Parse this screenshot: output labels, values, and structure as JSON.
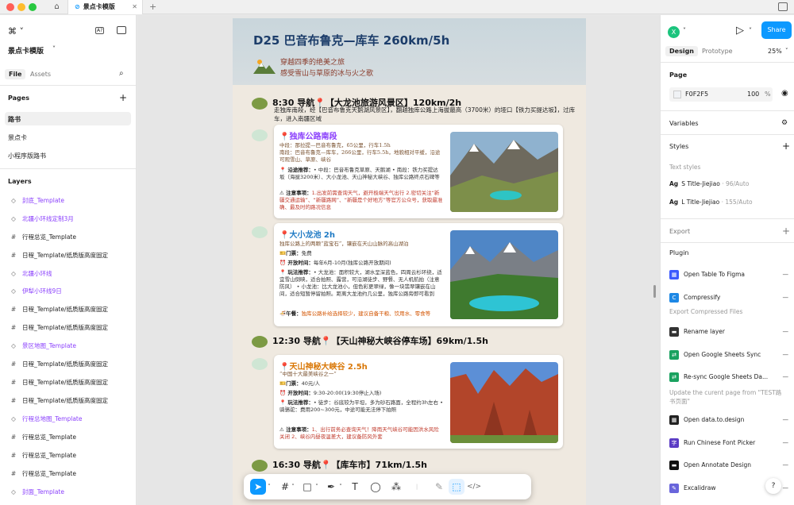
{
  "tabbar": {
    "tab_title": "景点卡模版",
    "close": "✕",
    "plus": "+"
  },
  "left_panel": {
    "file_name": "景点卡模版",
    "tab_file": "File",
    "tab_assets": "Assets",
    "pages_title": "Pages",
    "pages": [
      "路书",
      "景点卡",
      "小程序版路书"
    ],
    "layers_title": "Layers",
    "layers": [
      {
        "label": "封底_Template",
        "style": "purple",
        "icon": "◇"
      },
      {
        "label": "北疆小环线定制3月",
        "style": "purple",
        "icon": "◇"
      },
      {
        "label": "行程总览_Template",
        "style": "",
        "icon": "#"
      },
      {
        "label": "日程_Template/纸质版高度固定",
        "style": "",
        "icon": "#"
      },
      {
        "label": "北疆小环线",
        "style": "purple",
        "icon": "◇"
      },
      {
        "label": "伊犁小环线9日",
        "style": "purple",
        "icon": "◇"
      },
      {
        "label": "日程_Template/纸质版高度固定",
        "style": "",
        "icon": "#"
      },
      {
        "label": "日程_Template/纸质版高度固定",
        "style": "",
        "icon": "#"
      },
      {
        "label": "景区地图_Template",
        "style": "purple",
        "icon": "◇"
      },
      {
        "label": "日程_Template/纸质版高度固定",
        "style": "",
        "icon": "#"
      },
      {
        "label": "日程_Template/纸质版高度固定",
        "style": "",
        "icon": "#"
      },
      {
        "label": "日程_Template/纸质版高度固定",
        "style": "",
        "icon": "#"
      },
      {
        "label": "行程总地图_Template",
        "style": "purple",
        "icon": "◇"
      },
      {
        "label": "行程总览_Template",
        "style": "",
        "icon": "#"
      },
      {
        "label": "行程总览_Template",
        "style": "",
        "icon": "#"
      },
      {
        "label": "行程总览_Template",
        "style": "",
        "icon": "#"
      },
      {
        "label": "封面_Template",
        "style": "purple",
        "icon": "◇"
      }
    ]
  },
  "right_panel": {
    "avatar": "X",
    "share": "Share",
    "tab_design": "Design",
    "tab_prototype": "Prototype",
    "zoom": "25%",
    "page_title": "Page",
    "page_color": "F0F2F5",
    "page_opacity": "100",
    "page_pct": "%",
    "variables": "Variables",
    "styles": "Styles",
    "text_styles": "Text styles",
    "style1_name": "S Title-Jiejiao",
    "style1_meta": "· 96/Auto",
    "style2_name": "L Title-Jiejiao",
    "style2_meta": "· 155/Auto",
    "export": "Export",
    "plugin": "Plugin",
    "plugins": [
      {
        "name": "Open Table To Figma",
        "color": "#3d5afe",
        "glyph": "▦"
      },
      {
        "name": "Compressify",
        "color": "#1e88e5",
        "glyph": "C"
      },
      {
        "name": "Rename layer",
        "color": "#333333",
        "glyph": "▬"
      },
      {
        "name": "Open Google Sheets Sync",
        "color": "#1aa260",
        "glyph": "⇄"
      },
      {
        "name": "Re-sync Google Sheets Da...",
        "color": "#1aa260",
        "glyph": "⇄"
      },
      {
        "name": "Open data.to.design",
        "color": "#222222",
        "glyph": "▦"
      },
      {
        "name": "Run Chinese Font Picker",
        "color": "#5b3cc4",
        "glyph": "字"
      },
      {
        "name": "Open Annotate Design",
        "color": "#111111",
        "glyph": "▬"
      },
      {
        "name": "Excalidraw",
        "color": "#6965db",
        "glyph": "✎"
      }
    ],
    "compressify_sub": "Export Compressed Files",
    "resync_sub": "Update the curent page from \"TEST路书页面\"",
    "help": "?"
  },
  "frame": {
    "title": "D25 巴音布鲁克—库车 260km/5h",
    "sub1": "穿越四季的绝美之旅",
    "sub2": "感受雪山与草原的冰与火之歌",
    "nav1": "8:30 导航📍【大龙池旅游风景区】120km/2h",
    "nav1_desc": "走独库南段，经【巴音布鲁克天鹅湖风景区】，翻越独库公路上海拔最高（3700米）的垭口【铁力买提达坂】，过库车，进入南疆区域",
    "card1": {
      "title": "📍独库公路南段",
      "lines": [
        "中段：那拉提—巴音布鲁克，65公里，行车1.5h",
        "南段：巴音布鲁克—库车，266公里，行车5.5h，地貌相对平缓，沿途可观雪山、草原、峡谷"
      ],
      "rec_label": "📍 沿途推荐：",
      "rec": "• 中段：巴音布鲁克草原、天鹅湖 • 南段：铁力买提达坂（海拔3200米）、大小龙池、天山神秘大峡谷、独库公路终点石碑等",
      "note_label": "⚠ 注意事项：",
      "note": "1.出发前需查询天气，避开极端天气出行 2.密切关注“新疆交通运输”、“新疆路网”、“新疆是个好地方”等官方公众号，获取最准确、最及时的路况信息"
    },
    "card2": {
      "title": "📍大小龙池 2h",
      "intro": "独库公路上的两颗“蓝宝石”，镶嵌在天山山脉的高山湖泊",
      "ticket_label": "🎫门票：",
      "ticket": "免费",
      "open_label": "⏰ 开放时间：",
      "open": "每年6月-10月(独库公路开放期间)",
      "play_label": "📍 玩法推荐：",
      "play": "• 大龙池：面积较大，湖水呈深蓝色，四周云杉环绕，适宜雪山倒映，适合拍照、露营，可沿湖徒步、野餐、无人机航拍（注意防风） • 小龙池：比大龙池小，但色彩更翠绿，像一块翡翠镶嵌在山间，适合短暂停留拍照。距离大龙池约几公里，独库公路旁即可看到",
      "lunch_label": "🍜午餐：",
      "lunch": "独库公路补给选择较少，建议自备干粮、饮用水、零食等"
    },
    "nav2": "12:30 导航📍【天山神秘大峡谷停车场】69km/1.5h",
    "card3": {
      "title": "📍天山神秘大峡谷 2.5h",
      "intro": "“中国十大最美峡谷之一”",
      "ticket_label": "🎫门票：",
      "ticket": "40元/人",
      "open_label": "⏰ 开放时间：",
      "open": "9:30-20:00(19:30停止入场)",
      "play_label": "📍 玩法推荐：",
      "play": "• 徒步：谷底较为平坦，多为砂石路面，全程约3h左右 • 骑骆驼：费用200~300元，中途可能无法停下拍照",
      "note_label": "⚠ 注意事项：",
      "note": "1、出行前务必查询天气！降雨天气峡谷可能因洪水风险关闭 2、峡谷内昼夜温差大，建议备防风外套"
    },
    "nav3": "16:30 导航📍【库车市】71km/1.5h"
  },
  "toolbar": {
    "tools": [
      "move-tool",
      "frame-tool",
      "shape-tool",
      "pen-tool",
      "text-tool",
      "comment-tool",
      "actions-tool",
      "draw-mode",
      "design-mode",
      "dev-mode"
    ]
  }
}
